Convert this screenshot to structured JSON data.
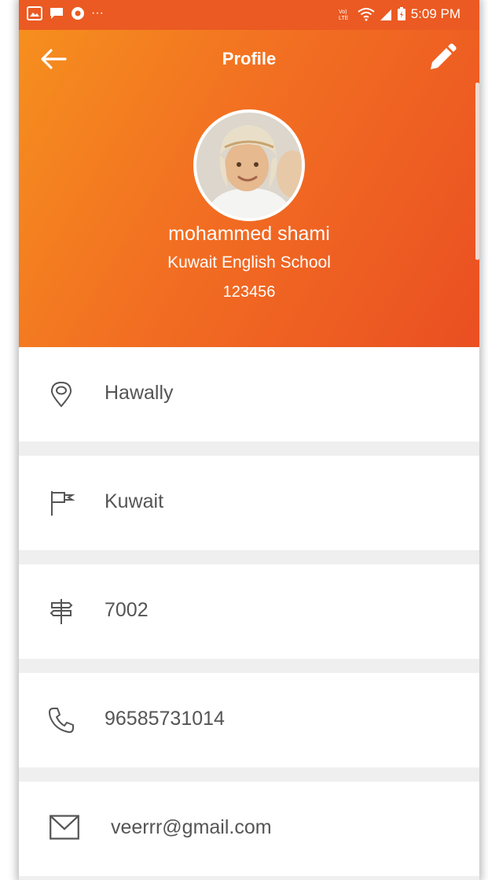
{
  "status": {
    "time": "5:09 PM",
    "ellipsis": "···"
  },
  "app": {
    "title": "Profile"
  },
  "profile": {
    "name": "mohammed shami",
    "school": "Kuwait English School",
    "code": "123456"
  },
  "details": [
    {
      "icon": "location-pin-icon",
      "value": "Hawally"
    },
    {
      "icon": "flag-icon",
      "value": "Kuwait"
    },
    {
      "icon": "signpost-icon",
      "value": "7002"
    },
    {
      "icon": "phone-icon",
      "value": "96585731014"
    },
    {
      "icon": "mail-icon",
      "value": "veerrr@gmail.com"
    }
  ],
  "colors": {
    "header_start": "#f6911e",
    "header_end": "#ea4f22",
    "status_bar": "#eb5a22",
    "row_text": "#555555",
    "separator": "#efefef"
  }
}
